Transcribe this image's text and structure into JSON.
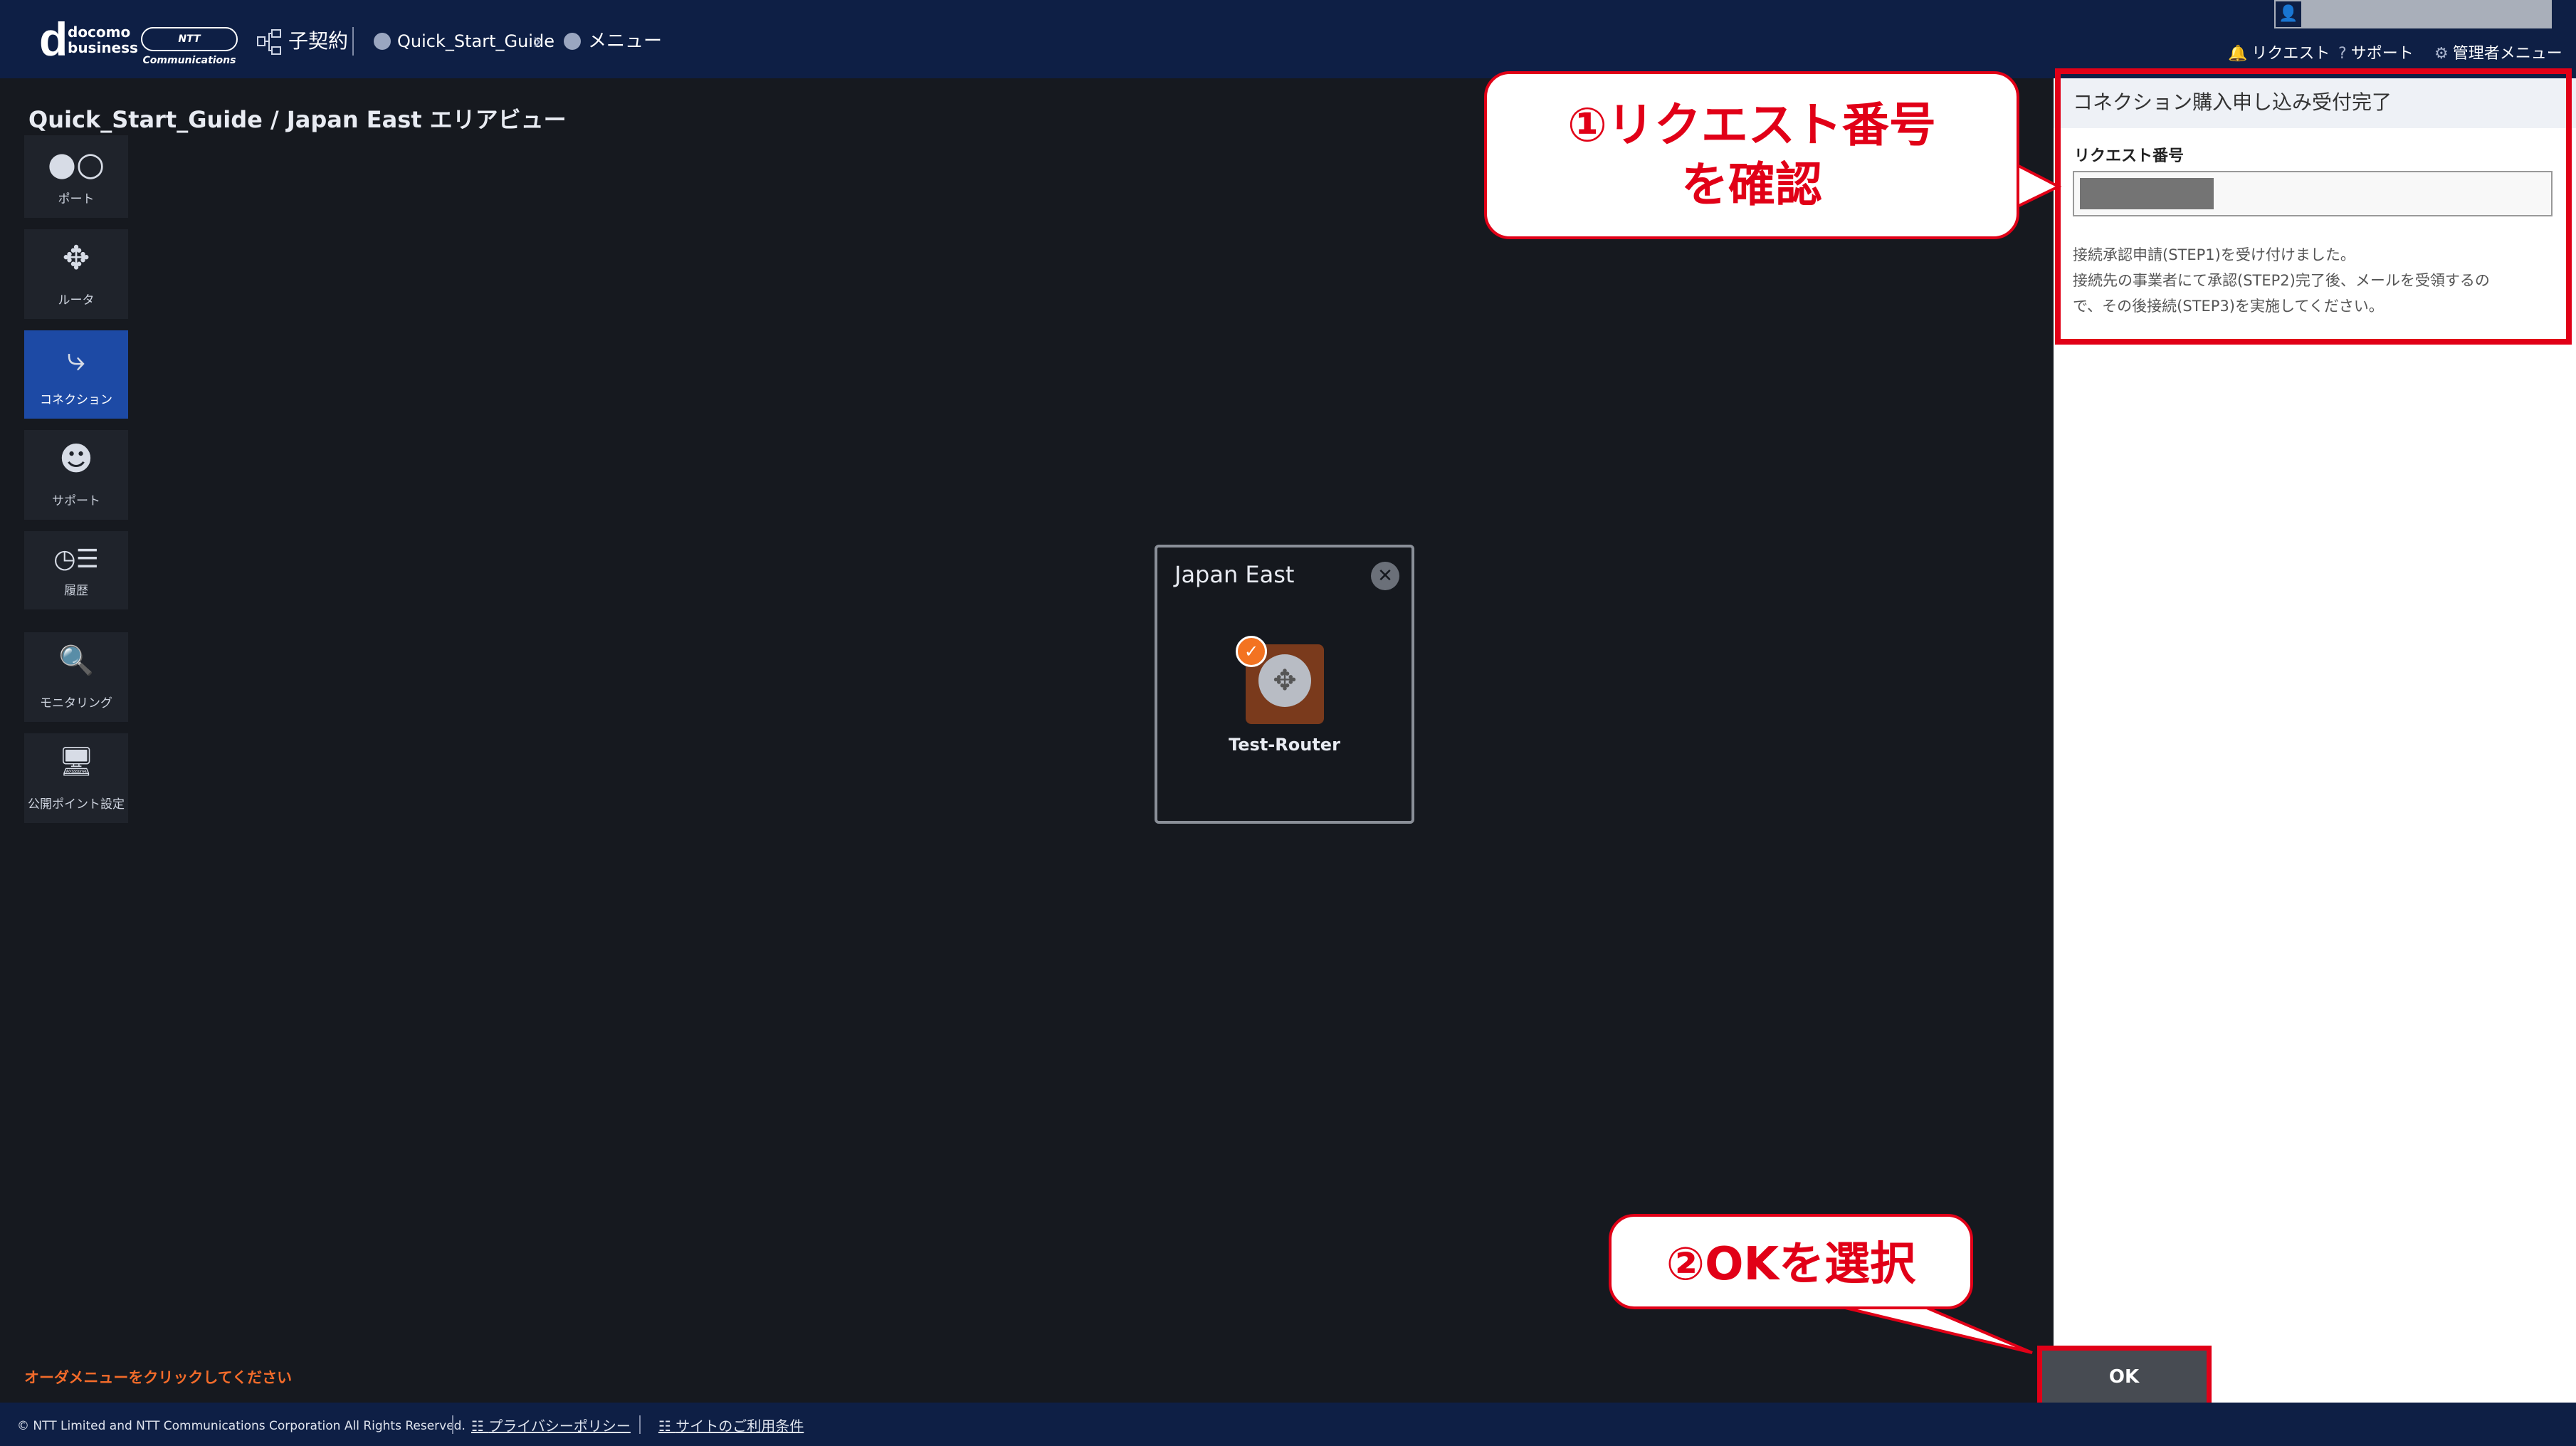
{
  "header": {
    "logo_top": "docomo",
    "logo_bottom": "business",
    "logo_letter": "d",
    "ntt_badge": "NTT Communications",
    "sub_contract": "子契約",
    "breadcrumb_1": "Quick_Start_Guide",
    "breadcrumb_sep": "›",
    "breadcrumb_2": "メニュー",
    "nav_request": "リクエスト",
    "nav_support": "サポート",
    "nav_admin": "管理者メニュー"
  },
  "page_title": "Quick_Start_Guide / Japan East エリアビュー",
  "rail": [
    {
      "label": "ポート",
      "icon": "port-icon"
    },
    {
      "label": "ルータ",
      "icon": "router-icon"
    },
    {
      "label": "コネクション",
      "icon": "connection-icon"
    },
    {
      "label": "サポート",
      "icon": "support-icon"
    },
    {
      "label": "履歴",
      "icon": "history-icon"
    },
    {
      "label": "モニタリング",
      "icon": "monitoring-icon"
    },
    {
      "label": "公開ポイント設定",
      "icon": "public-point-icon"
    }
  ],
  "area": {
    "title": "Japan East",
    "router_label": "Test-Router"
  },
  "order_hint": "オーダメニューをクリックしてください",
  "panel": {
    "title": "コネクション購入申し込み受付完了",
    "request_label": "リクエスト番号",
    "message_1": "接続承認申請(STEP1)を受け付けました。",
    "message_2": "接続先の事業者にて承認(STEP2)完了後、メールを受領するの",
    "message_3": "で、その後接続(STEP3)を実施してください。",
    "ok_label": "OK"
  },
  "callouts": {
    "c1_line1": "①リクエスト番号",
    "c1_line2": "を確認",
    "c2": "②OKを選択"
  },
  "footer": {
    "copyright": "© NTT Limited and NTT Communications Corporation All Rights Reserved.",
    "privacy": "プライバシーポリシー",
    "terms": "サイトのご利用条件"
  },
  "colors": {
    "header_bg": "#0e1f45",
    "accent_blue": "#1d4aa5",
    "highlight_red": "#e10017",
    "router_orange": "#f37321"
  }
}
